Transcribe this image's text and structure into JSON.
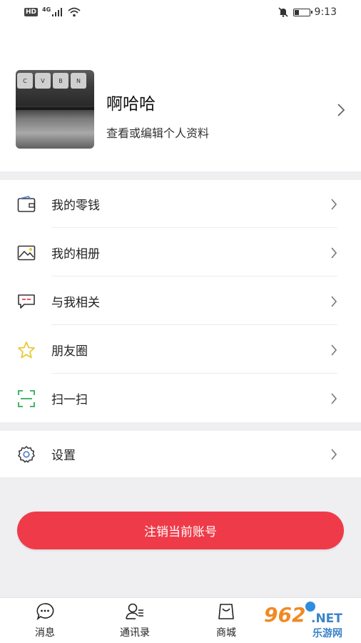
{
  "status_bar": {
    "left": {
      "hd": "HD",
      "network": "4G"
    },
    "time": "9:13"
  },
  "profile": {
    "name": "啊哈哈",
    "subtitle": "查看或编辑个人资料",
    "avatar_keys": [
      "C",
      "V",
      "B",
      "N"
    ]
  },
  "menu_group_1": [
    {
      "label": "我的零钱",
      "icon": "wallet-icon"
    },
    {
      "label": "我的相册",
      "icon": "photo-album-icon"
    },
    {
      "label": "与我相关",
      "icon": "message-bubble-icon"
    },
    {
      "label": "朋友圈",
      "icon": "star-icon"
    },
    {
      "label": "扫一扫",
      "icon": "scan-icon"
    }
  ],
  "menu_group_2": [
    {
      "label": "设置",
      "icon": "gear-icon"
    }
  ],
  "logout_button": {
    "label": "注销当前账号"
  },
  "tabs": [
    {
      "label": "消息",
      "icon": "chat-bubble-icon"
    },
    {
      "label": "通讯录",
      "icon": "contacts-icon"
    },
    {
      "label": "商城",
      "icon": "shopping-bag-icon"
    }
  ],
  "watermark": {
    "num": "962",
    "net": ".NET",
    "cn": "乐游网"
  },
  "colors": {
    "accent_red": "#ef3b49",
    "section_gap": "#efeff2",
    "star_yellow": "#e8c93a",
    "scan_green": "#2fae57",
    "wallet_blue": "#4a79d4"
  }
}
